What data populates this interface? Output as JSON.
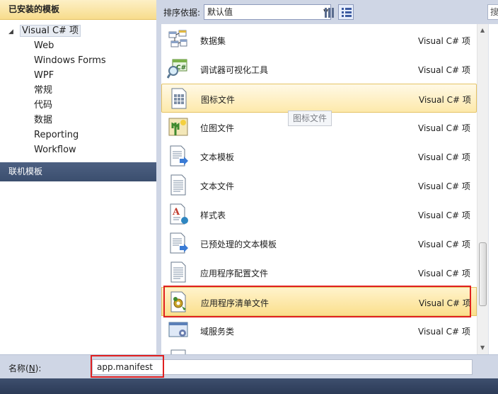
{
  "left_panel": {
    "installed_header": "已安装的模板",
    "tree": {
      "root": "Visual C# 项",
      "children": [
        "Web",
        "Windows Forms",
        "WPF",
        "常规",
        "代码",
        "数据",
        "Reporting",
        "Workflow"
      ]
    },
    "online_header": "联机模板"
  },
  "toolbar": {
    "sort_label": "排序依据:",
    "sort_value": "默认值",
    "search_stub": "搜"
  },
  "items": [
    {
      "name": "数据集",
      "lang": "Visual C# 项",
      "icon": "dataset-icon"
    },
    {
      "name": "调试器可视化工具",
      "lang": "Visual C# 项",
      "icon": "debugger-visualizer-icon"
    },
    {
      "name": "图标文件",
      "lang": "Visual C# 项",
      "icon": "icon-file-icon"
    },
    {
      "name": "位图文件",
      "lang": "Visual C# 项",
      "icon": "bitmap-file-icon"
    },
    {
      "name": "文本模板",
      "lang": "Visual C# 项",
      "icon": "text-template-icon"
    },
    {
      "name": "文本文件",
      "lang": "Visual C# 项",
      "icon": "text-file-icon"
    },
    {
      "name": "样式表",
      "lang": "Visual C# 项",
      "icon": "stylesheet-icon"
    },
    {
      "name": "已预处理的文本模板",
      "lang": "Visual C# 项",
      "icon": "preprocessed-template-icon"
    },
    {
      "name": "应用程序配置文件",
      "lang": "Visual C# 项",
      "icon": "app-config-icon"
    },
    {
      "name": "应用程序清单文件",
      "lang": "Visual C# 项",
      "icon": "app-manifest-icon"
    },
    {
      "name": "域服务类",
      "lang": "Visual C# 项",
      "icon": "domain-service-icon"
    }
  ],
  "tooltip": "图标文件",
  "bottom": {
    "name_label_prefix": "名称(",
    "name_label_key": "N",
    "name_label_suffix": "):",
    "name_value": "app.manifest"
  },
  "colors": {
    "header_dark": "#3b4e6e",
    "highlight_gold": "#fbdf8c",
    "annotation_red": "#e02020"
  }
}
